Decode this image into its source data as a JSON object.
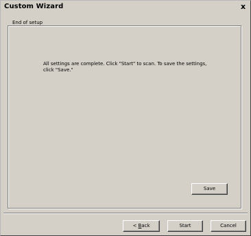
{
  "window": {
    "title": "Custom Wizard",
    "close_glyph": "x"
  },
  "group": {
    "legend": "End of setup",
    "message": "All settings are complete. Click \"Start\" to scan. To save the settings, click \"Save.\""
  },
  "buttons": {
    "save": "Save",
    "back_prefix": "< ",
    "back_accel": "B",
    "back_rest": "ack",
    "start": "Start",
    "cancel": "Cancel"
  },
  "colors": {
    "face": "#d4d0c8",
    "shadow": "#808080",
    "highlight": "#ffffff"
  }
}
